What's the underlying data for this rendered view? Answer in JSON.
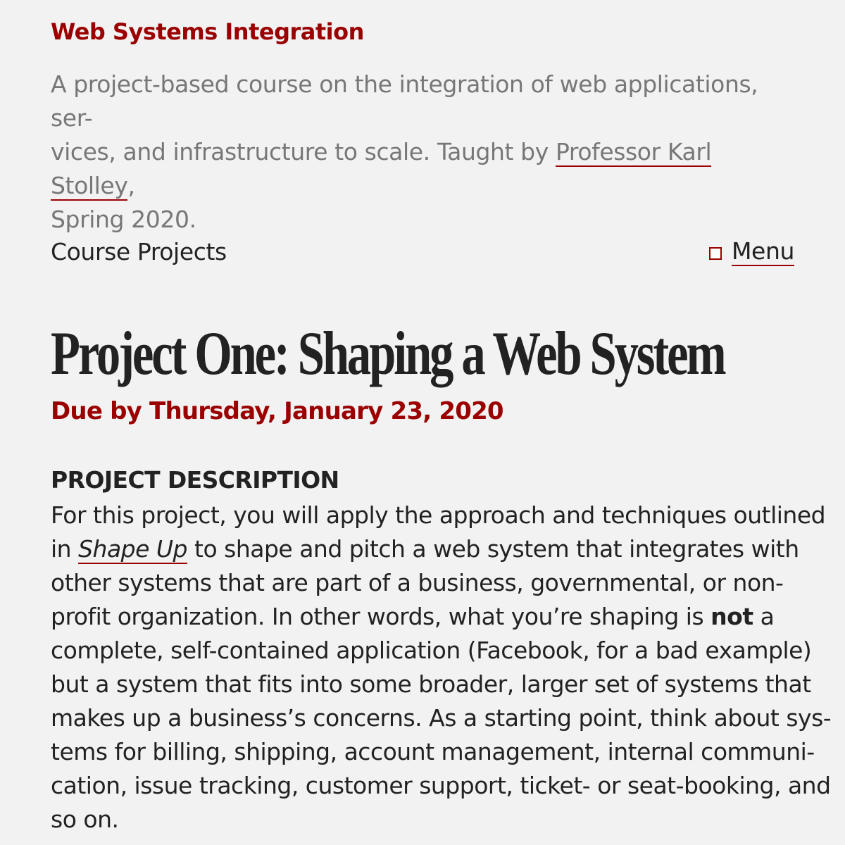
{
  "header": {
    "site_title": "Web Systems Integration",
    "tagline": {
      "line1": "A project-based course on the integration of web applications, ser-",
      "line2_before": "vices, and infrastructure to scale. Taught by ",
      "professor_link": "Professor Karl Stolley",
      "line2_after": ",",
      "line3": "Spring 2020."
    }
  },
  "nav": {
    "section_label": "Course Projects",
    "menu_label": "Menu"
  },
  "main": {
    "title": "Project One: Shaping a Web System",
    "due": "Due by Thursday, January 23, 2020",
    "section_heading": "PROJECT DESCRIPTION",
    "description": {
      "l1": "For this project, you will apply the approach and techniques outlined",
      "l2_before": "in ",
      "l2_link": "Shape Up",
      "l2_after": " to shape and pitch a web system that integrates with",
      "l3": "other systems that are part of a business, governmental, or non-",
      "l4_before": "profit organization. In other words, what you’re shaping is ",
      "l4_bold": "not",
      "l4_after": " a",
      "l5": "complete, self-contained application (Facebook, for a bad example)",
      "l6": "but a system that fits into some broader, larger set of systems that",
      "l7": "makes up a business’s concerns. As a starting point, think about sys-",
      "l8": "tems for billing, shipping, account management, internal communi-",
      "l9": "cation, issue tracking, customer support, ticket- or seat-booking, and",
      "l10": "so on."
    }
  },
  "colors": {
    "accent": "#9b0000",
    "background": "#f2f2f2",
    "text": "#222222",
    "muted": "#777777"
  },
  "icons": {
    "menu_toggle": "menu-checkbox-icon"
  }
}
